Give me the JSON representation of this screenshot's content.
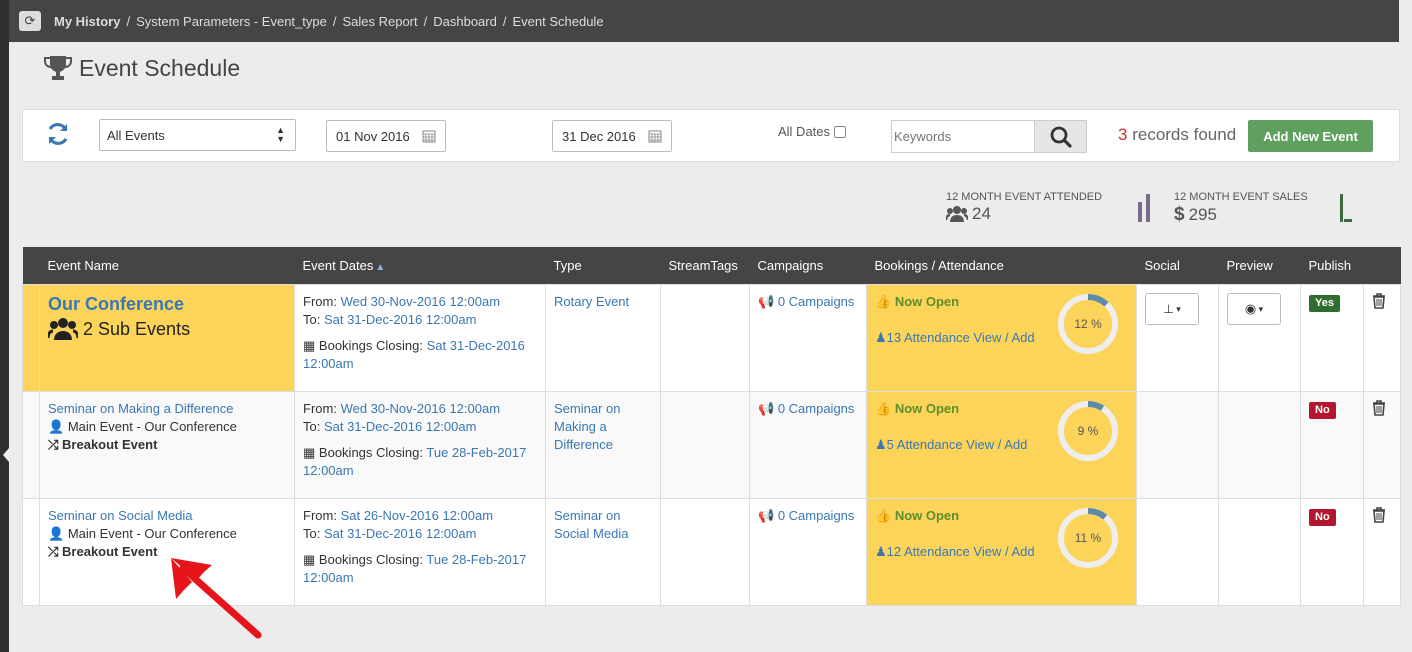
{
  "breadcrumbs": [
    "My History",
    "System Parameters - Event_type",
    "Sales Report",
    "Dashboard",
    "Event Schedule"
  ],
  "page_title": "Event Schedule",
  "filters": {
    "event_filter": "All Events",
    "date_from": "01 Nov 2016",
    "date_to": "31 Dec 2016",
    "all_dates_label": "All Dates",
    "keywords_placeholder": "Keywords",
    "records_count": "3",
    "records_label": "records found",
    "add_button": "Add New Event"
  },
  "stats": {
    "attended_label": "12 MONTH EVENT ATTENDED",
    "attended_value": "24",
    "sales_label": "12 MONTH EVENT SALES",
    "sales_currency": "$",
    "sales_value": "295"
  },
  "table": {
    "columns": [
      "Event Name",
      "Event Dates",
      "Type",
      "StreamTags",
      "Campaigns",
      "Bookings / Attendance",
      "Social",
      "Preview",
      "Publish"
    ],
    "rows": [
      {
        "name": "Our Conference",
        "sub_events": "2 Sub Events",
        "from_label": "From:",
        "from": "Wed 30-Nov-2016 12:00am",
        "to_label": "To:",
        "to": "Sat 31-Dec-2016 12:00am",
        "closing_label": "Bookings Closing:",
        "closing": "Sat 31-Dec-2016 12:00am",
        "type": "Rotary Event",
        "campaigns": "0 Campaigns",
        "status": "Now Open",
        "attendance": "13 Attendance View / Add",
        "percent_label": "12 %",
        "percent": 12,
        "publish": "Yes"
      },
      {
        "name": "Seminar on Making a Difference",
        "main_event": "Main Event - Our Conference",
        "kind": "Breakout Event",
        "from_label": "From:",
        "from": "Wed 30-Nov-2016 12:00am",
        "to_label": "To:",
        "to": "Sat 31-Dec-2016 12:00am",
        "closing_label": "Bookings Closing:",
        "closing": "Tue 28-Feb-2017 12:00am",
        "type": "Seminar on Making a Difference",
        "campaigns": "0 Campaigns",
        "status": "Now Open",
        "attendance": "5 Attendance View / Add",
        "percent_label": "9 %",
        "percent": 9,
        "publish": "No"
      },
      {
        "name": "Seminar on Social Media",
        "main_event": "Main Event - Our Conference",
        "kind": "Breakout Event",
        "from_label": "From:",
        "from": "Sat 26-Nov-2016 12:00am",
        "to_label": "To:",
        "to": "Sat 31-Dec-2016 12:00am",
        "closing_label": "Bookings Closing:",
        "closing": "Tue 28-Feb-2017 12:00am",
        "type": "Seminar on Social Media",
        "campaigns": "0 Campaigns",
        "status": "Now Open",
        "attendance": "12 Attendance View / Add",
        "percent_label": "11 %",
        "percent": 11,
        "publish": "No"
      }
    ]
  },
  "colors": {
    "topbar": "#454545",
    "highlight": "#fdd45a",
    "link": "#3a78b3",
    "add_button": "#5fa05f",
    "yes_badge": "#2f6e2f",
    "no_badge": "#b3172f",
    "annotation_arrow": "#e8141b"
  }
}
